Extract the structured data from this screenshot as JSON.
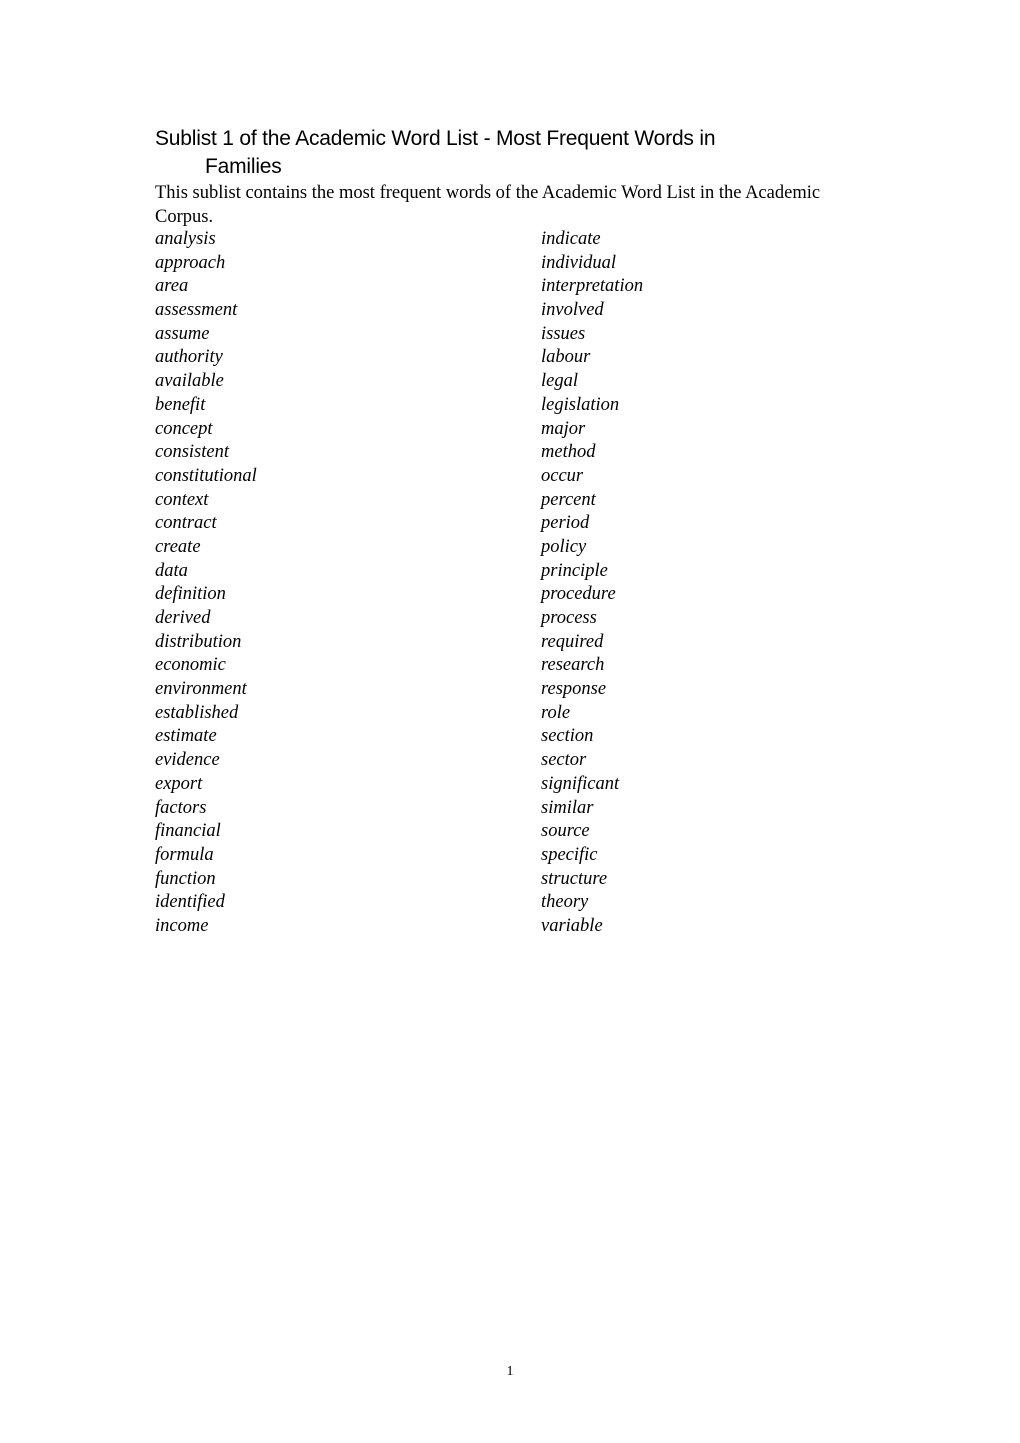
{
  "document": {
    "title_line1": "Sublist 1 of the Academic Word List - Most Frequent Words in",
    "title_line2": "Families",
    "intro": "This sublist contains the most frequent words of the Academic Word List in the Academic Corpus.",
    "page_number": "1"
  },
  "words": {
    "rows": [
      {
        "left": "analysis",
        "right": "indicate"
      },
      {
        "left": "approach",
        "right": "individual"
      },
      {
        "left": "area",
        "right": "interpretation"
      },
      {
        "left": "assessment",
        "right": "involved"
      },
      {
        "left": "assume",
        "right": "issues"
      },
      {
        "left": "authority",
        "right": "labour"
      },
      {
        "left": "available",
        "right": "legal"
      },
      {
        "left": "benefit",
        "right": "legislation"
      },
      {
        "left": "concept",
        "right": "major"
      },
      {
        "left": "consistent",
        "right": "method"
      },
      {
        "left": "constitutional",
        "right": "occur"
      },
      {
        "left": "context",
        "right": "percent"
      },
      {
        "left": "contract",
        "right": "period"
      },
      {
        "left": "create",
        "right": "policy"
      },
      {
        "left": "data",
        "right": "principle"
      },
      {
        "left": "definition",
        "right": "procedure"
      },
      {
        "left": "derived",
        "right": "process"
      },
      {
        "left": "distribution",
        "right": "required"
      },
      {
        "left": "economic",
        "right": "research"
      },
      {
        "left": "environment",
        "right": "response"
      },
      {
        "left": "established",
        "right": "role"
      },
      {
        "left": "estimate",
        "right": "section"
      },
      {
        "left": "evidence",
        "right": "sector"
      },
      {
        "left": "export",
        "right": "significant"
      },
      {
        "left": "factors",
        "right": "similar"
      },
      {
        "left": "financial",
        "right": "source"
      },
      {
        "left": "formula",
        "right": "specific"
      },
      {
        "left": "function",
        "right": "structure"
      },
      {
        "left": "identified",
        "right": "theory"
      },
      {
        "left": "income",
        "right": "variable"
      }
    ]
  }
}
